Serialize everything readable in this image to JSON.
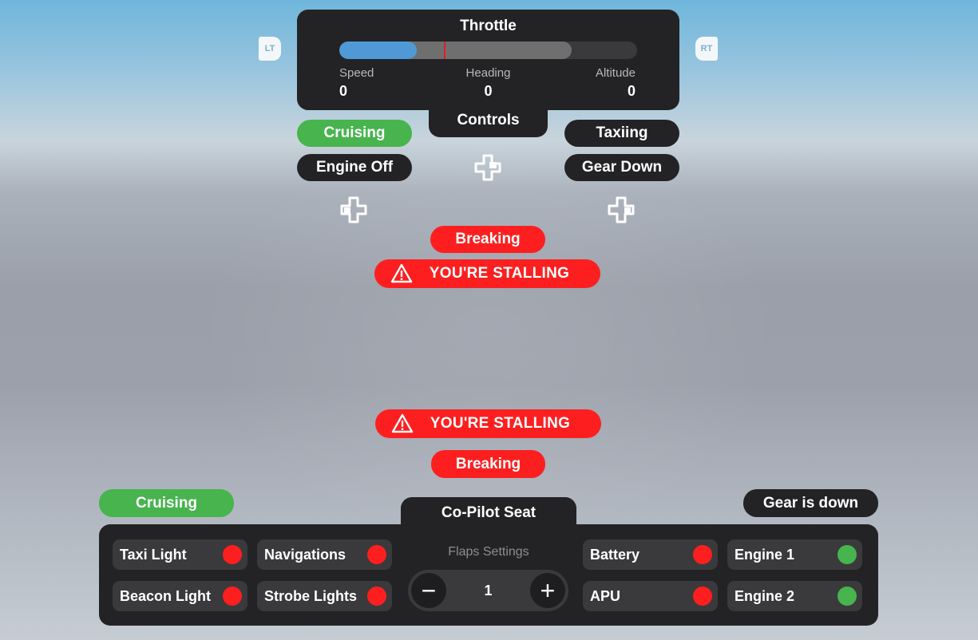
{
  "throttle": {
    "title": "Throttle",
    "level": 0.26,
    "secondary_level": 0.78,
    "marker": 0.35,
    "readouts": [
      {
        "label": "Speed",
        "value": "0"
      },
      {
        "label": "Heading",
        "value": "0"
      },
      {
        "label": "Altitude",
        "value": "0"
      }
    ]
  },
  "triggers": {
    "left": "LT",
    "right": "RT"
  },
  "controls": {
    "title": "Controls",
    "cruising": "Cruising",
    "engine": "Engine Off",
    "taxiing": "Taxiing",
    "gear": "Gear Down",
    "dpad_icon": "dpad-icon"
  },
  "alerts_top": {
    "braking": "Breaking",
    "stall": "YOU'RE STALLING"
  },
  "alerts_bottom": {
    "stall": "YOU'RE STALLING",
    "braking": "Breaking"
  },
  "copilot": {
    "status_left": "Cruising",
    "status_right": "Gear is down",
    "seat_title": "Co-Pilot Seat",
    "flaps": {
      "label": "Flaps Settings",
      "value": "1",
      "minus": "−",
      "plus": "+"
    },
    "switches": [
      {
        "label": "Taxi Light",
        "on": false
      },
      {
        "label": "Navigations",
        "on": false
      },
      {
        "label": "Beacon Light",
        "on": false
      },
      {
        "label": "Strobe Lights",
        "on": false
      },
      {
        "label": "Battery",
        "on": false
      },
      {
        "label": "Engine 1",
        "on": true
      },
      {
        "label": "APU",
        "on": false
      },
      {
        "label": "Engine 2",
        "on": true
      }
    ]
  },
  "colors": {
    "on": "#47b44e",
    "off": "#fd1f1f",
    "panel": "#232325",
    "accent": "#4f9ad6"
  }
}
